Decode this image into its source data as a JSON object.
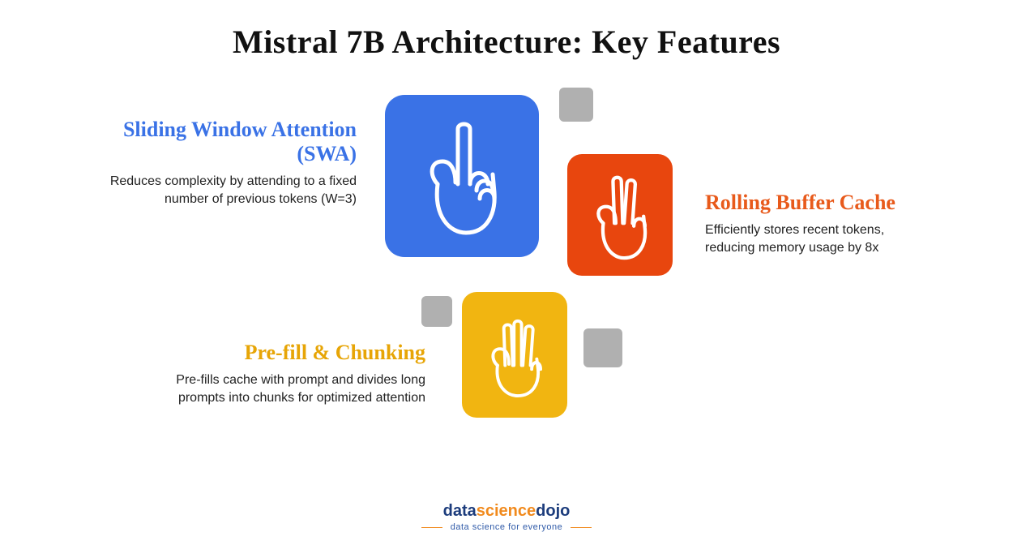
{
  "title": "Mistral 7B Architecture: Key Features",
  "features": {
    "swa": {
      "heading": "Sliding Window Attention (SWA)",
      "desc": "Reduces complexity by attending to a fixed number of previous tokens (W=3)",
      "color": "#3a72e6",
      "icon": "hand-one-icon"
    },
    "buffer": {
      "heading": "Rolling Buffer Cache",
      "desc": "Efficiently stores recent tokens, reducing memory usage by 8x",
      "color": "#e8460e",
      "icon": "hand-two-icon"
    },
    "chunking": {
      "heading": "Pre-fill & Chunking",
      "desc": "Pre-fills cache with prompt and divides long prompts into chunks for optimized attention",
      "color": "#f1b511",
      "icon": "hand-three-icon"
    }
  },
  "branding": {
    "part1": "data",
    "part2": "science",
    "part3": "dojo",
    "tagline": "data science for everyone"
  }
}
